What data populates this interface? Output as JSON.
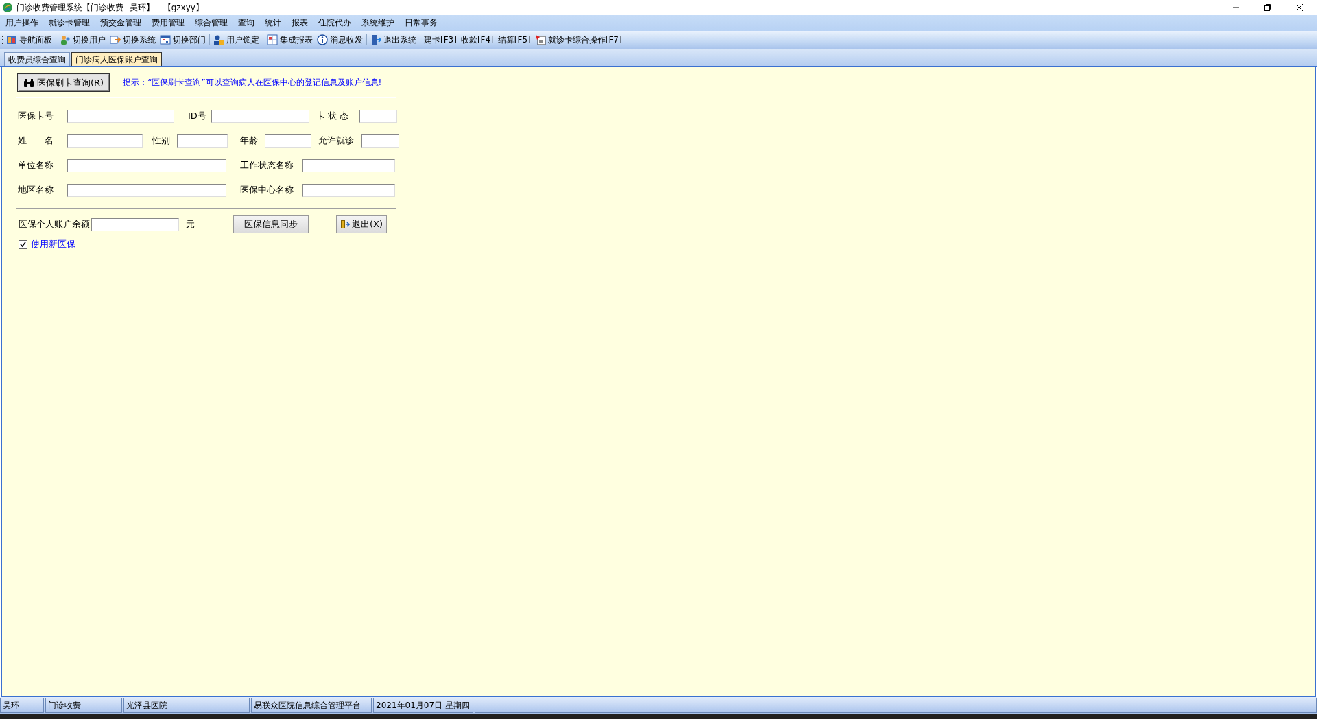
{
  "window": {
    "title": "门诊收费管理系统【门诊收费--吴环】---【gzxyy】"
  },
  "menu": [
    "用户操作",
    "就诊卡管理",
    "预交金管理",
    "费用管理",
    "综合管理",
    "查询",
    "统计",
    "报表",
    "住院代办",
    "系统维护",
    "日常事务"
  ],
  "toolbar": [
    [
      {
        "label": "导航面板",
        "kind": "icon"
      }
    ],
    [
      {
        "label": "切换用户",
        "kind": "icon"
      },
      {
        "label": "切换系统",
        "kind": "icon"
      },
      {
        "label": "切换部门",
        "kind": "icon"
      }
    ],
    [
      {
        "label": "用户锁定",
        "kind": "icon"
      }
    ],
    [
      {
        "label": "集成报表",
        "kind": "icon"
      },
      {
        "label": "消息收发",
        "kind": "icon"
      }
    ],
    [
      {
        "label": "退出系统",
        "kind": "icon"
      }
    ],
    [
      {
        "label": "建卡[F3]",
        "kind": "text"
      },
      {
        "label": "收款[F4]",
        "kind": "text"
      },
      {
        "label": "结算[F5]",
        "kind": "text"
      },
      {
        "label": "就诊卡综合操作[F7]",
        "kind": "icon"
      }
    ]
  ],
  "tabs": [
    {
      "label": "收费员综合查询",
      "selected": false
    },
    {
      "label": "门诊病人医保账户查询",
      "selected": true
    }
  ],
  "query_button": "医保刷卡查询(R)",
  "hint": "提示：“医保刷卡查询”可以查询病人在医保中心的登记信息及账户信息!",
  "rows": [
    [
      {
        "label": "医保卡号"
      },
      {
        "label": "ID号"
      },
      {
        "label": "卡 状 态"
      }
    ],
    [
      {
        "label": "姓　　名"
      },
      {
        "label": "性别"
      },
      {
        "label": "年龄"
      },
      {
        "label": "允许就诊"
      }
    ],
    [
      {
        "label": "单位名称"
      },
      {
        "label": "工作状态名称"
      }
    ],
    [
      {
        "label": "地区名称"
      },
      {
        "label": "医保中心名称"
      }
    ]
  ],
  "balance": {
    "label": "医保个人账户余额",
    "unit": "元"
  },
  "sync_button": "医保信息同步",
  "exit_button": "退出(X)",
  "new_insurance": {
    "label": "使用新医保",
    "checked": true
  },
  "status_bar": [
    "吴环",
    "门诊收费",
    "光泽县医院",
    "易联众医院信息综合管理平台",
    "2021年01月07日 星期四"
  ]
}
